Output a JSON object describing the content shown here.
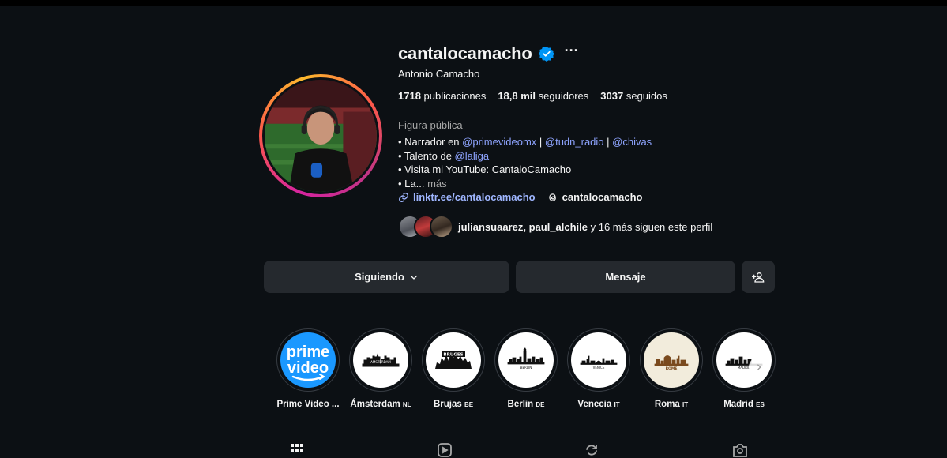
{
  "profile": {
    "username": "cantalocamacho",
    "more_label": "···",
    "full_name": "Antonio Camacho",
    "stats": {
      "posts_value": "1718",
      "posts_label": "publicaciones",
      "followers_value": "18,8 mil",
      "followers_label": "seguidores",
      "following_value": "3037",
      "following_label": "seguidos"
    },
    "category": "Figura pública",
    "bio": {
      "line1_prefix": "• Narrador en ",
      "line1_mention1": "@primevideomx",
      "line1_sep1": " | ",
      "line1_mention2": "@tudn_radio",
      "line1_sep2": " | ",
      "line1_mention3": "@chivas",
      "line2_prefix": "• Talento de ",
      "line2_mention": "@laliga",
      "line3": "• Visita mi YouTube: CantaloCamacho",
      "line4": "• La...",
      "more": "más"
    },
    "link": "linktr.ee/cantalocamacho",
    "threads_handle": "cantalocamacho",
    "followed_by": {
      "names": "juliansuaarez, paul_alchile",
      "rest": " y 16 más siguen este perfil"
    }
  },
  "buttons": {
    "following": "Siguiendo",
    "message": "Mensaje"
  },
  "highlights": [
    {
      "name": "Prime Video ...",
      "cc": "",
      "icon": "prime-video-logo"
    },
    {
      "name": "Ámsterdam",
      "cc": "NL",
      "icon": "amsterdam-skyline"
    },
    {
      "name": "Brujas",
      "cc": "BE",
      "icon": "bruges-skyline"
    },
    {
      "name": "Berlin",
      "cc": "DE",
      "icon": "berlin-skyline"
    },
    {
      "name": "Venecia",
      "cc": "IT",
      "icon": "venice-skyline"
    },
    {
      "name": "Roma",
      "cc": "IT",
      "icon": "rome-skyline"
    },
    {
      "name": "Madrid",
      "cc": "ES",
      "icon": "madrid-skyline"
    }
  ],
  "highlight_texts": {
    "prime_line1": "prime",
    "prime_line2": "video",
    "brujas_sign": "BRUGES",
    "berlin_sign": "BERLIN",
    "venice_sign": "VENICE",
    "rome_sign": "ROME",
    "madrid_sign": "MADRID",
    "amsterdam_sign": "AMSTERDAM"
  },
  "colors": {
    "background": "#0c1014",
    "mention": "#8ea4ff",
    "verified": "#0095f6",
    "button": "#25292e"
  }
}
